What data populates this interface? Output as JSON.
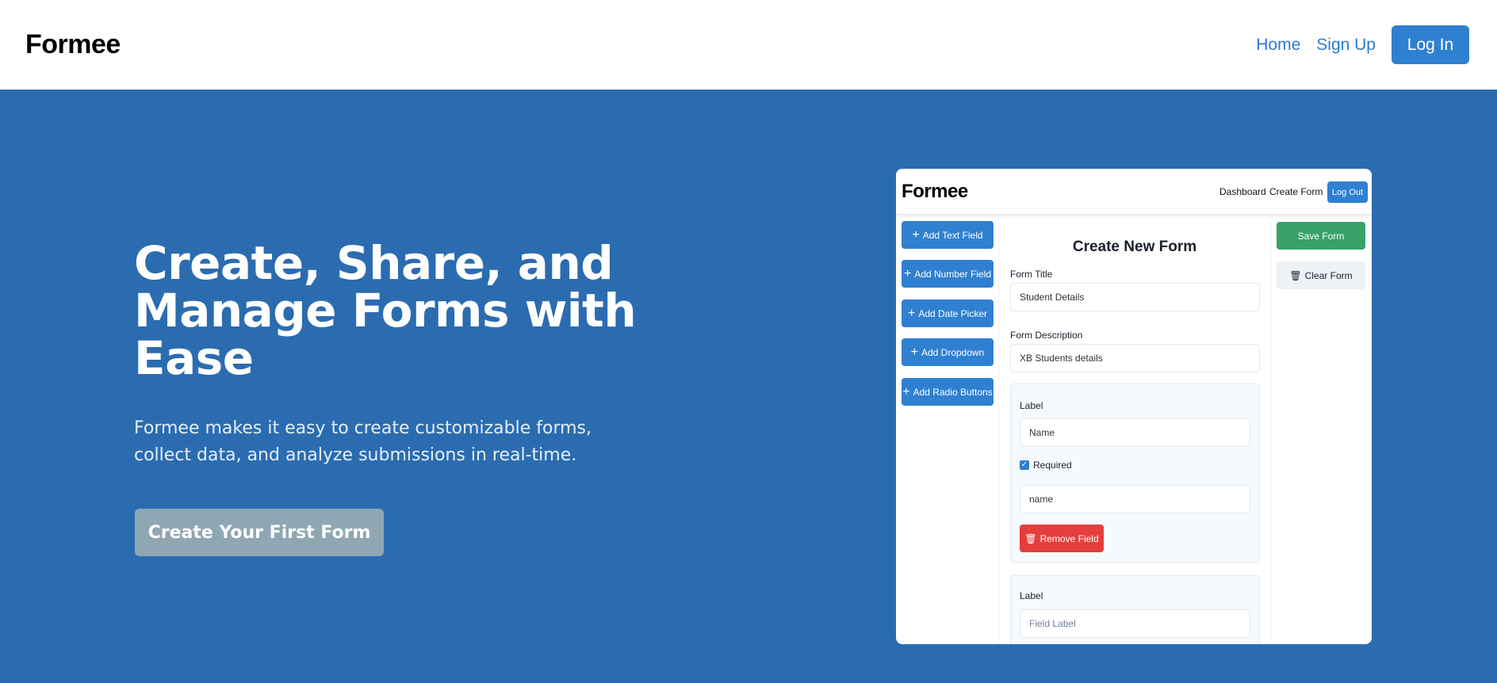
{
  "header": {
    "brand": "Formee",
    "nav": {
      "home": "Home",
      "signup": "Sign Up",
      "login": "Log In"
    }
  },
  "hero": {
    "title": "Create, Share, and Manage Forms with Ease",
    "subtitle": "Formee makes it easy to create customizable forms, collect data, and analyze submissions in real-time.",
    "cta": "Create Your First Form"
  },
  "preview": {
    "brand": "Formee",
    "nav": {
      "dashboard": "Dashboard",
      "create": "Create Form",
      "logout": "Log Out"
    },
    "toolbox": [
      {
        "label": "Add Text Field"
      },
      {
        "label": "Add Number Field"
      },
      {
        "label": "Add Date Picker"
      },
      {
        "label": "Add Dropdown"
      },
      {
        "label": "Add Radio Buttons"
      }
    ],
    "form": {
      "heading": "Create New Form",
      "title_label": "Form Title",
      "title_value": "Student Details",
      "desc_label": "Form Description",
      "desc_value": "XB Students details",
      "field1": {
        "label_caption": "Label",
        "label_value": "Name",
        "required_label": "Required",
        "required_checked": true,
        "name_value": "name",
        "remove": "Remove Field"
      },
      "field2": {
        "label_caption": "Label",
        "label_placeholder": "Field Label"
      }
    },
    "actions": {
      "save": "Save Form",
      "clear": "Clear Form"
    }
  },
  "colors": {
    "hero_bg": "#2b6cb0",
    "primary": "#2f80d1",
    "cta_bg": "#8fa7b3",
    "save": "#38a169",
    "danger": "#e53e3e"
  }
}
